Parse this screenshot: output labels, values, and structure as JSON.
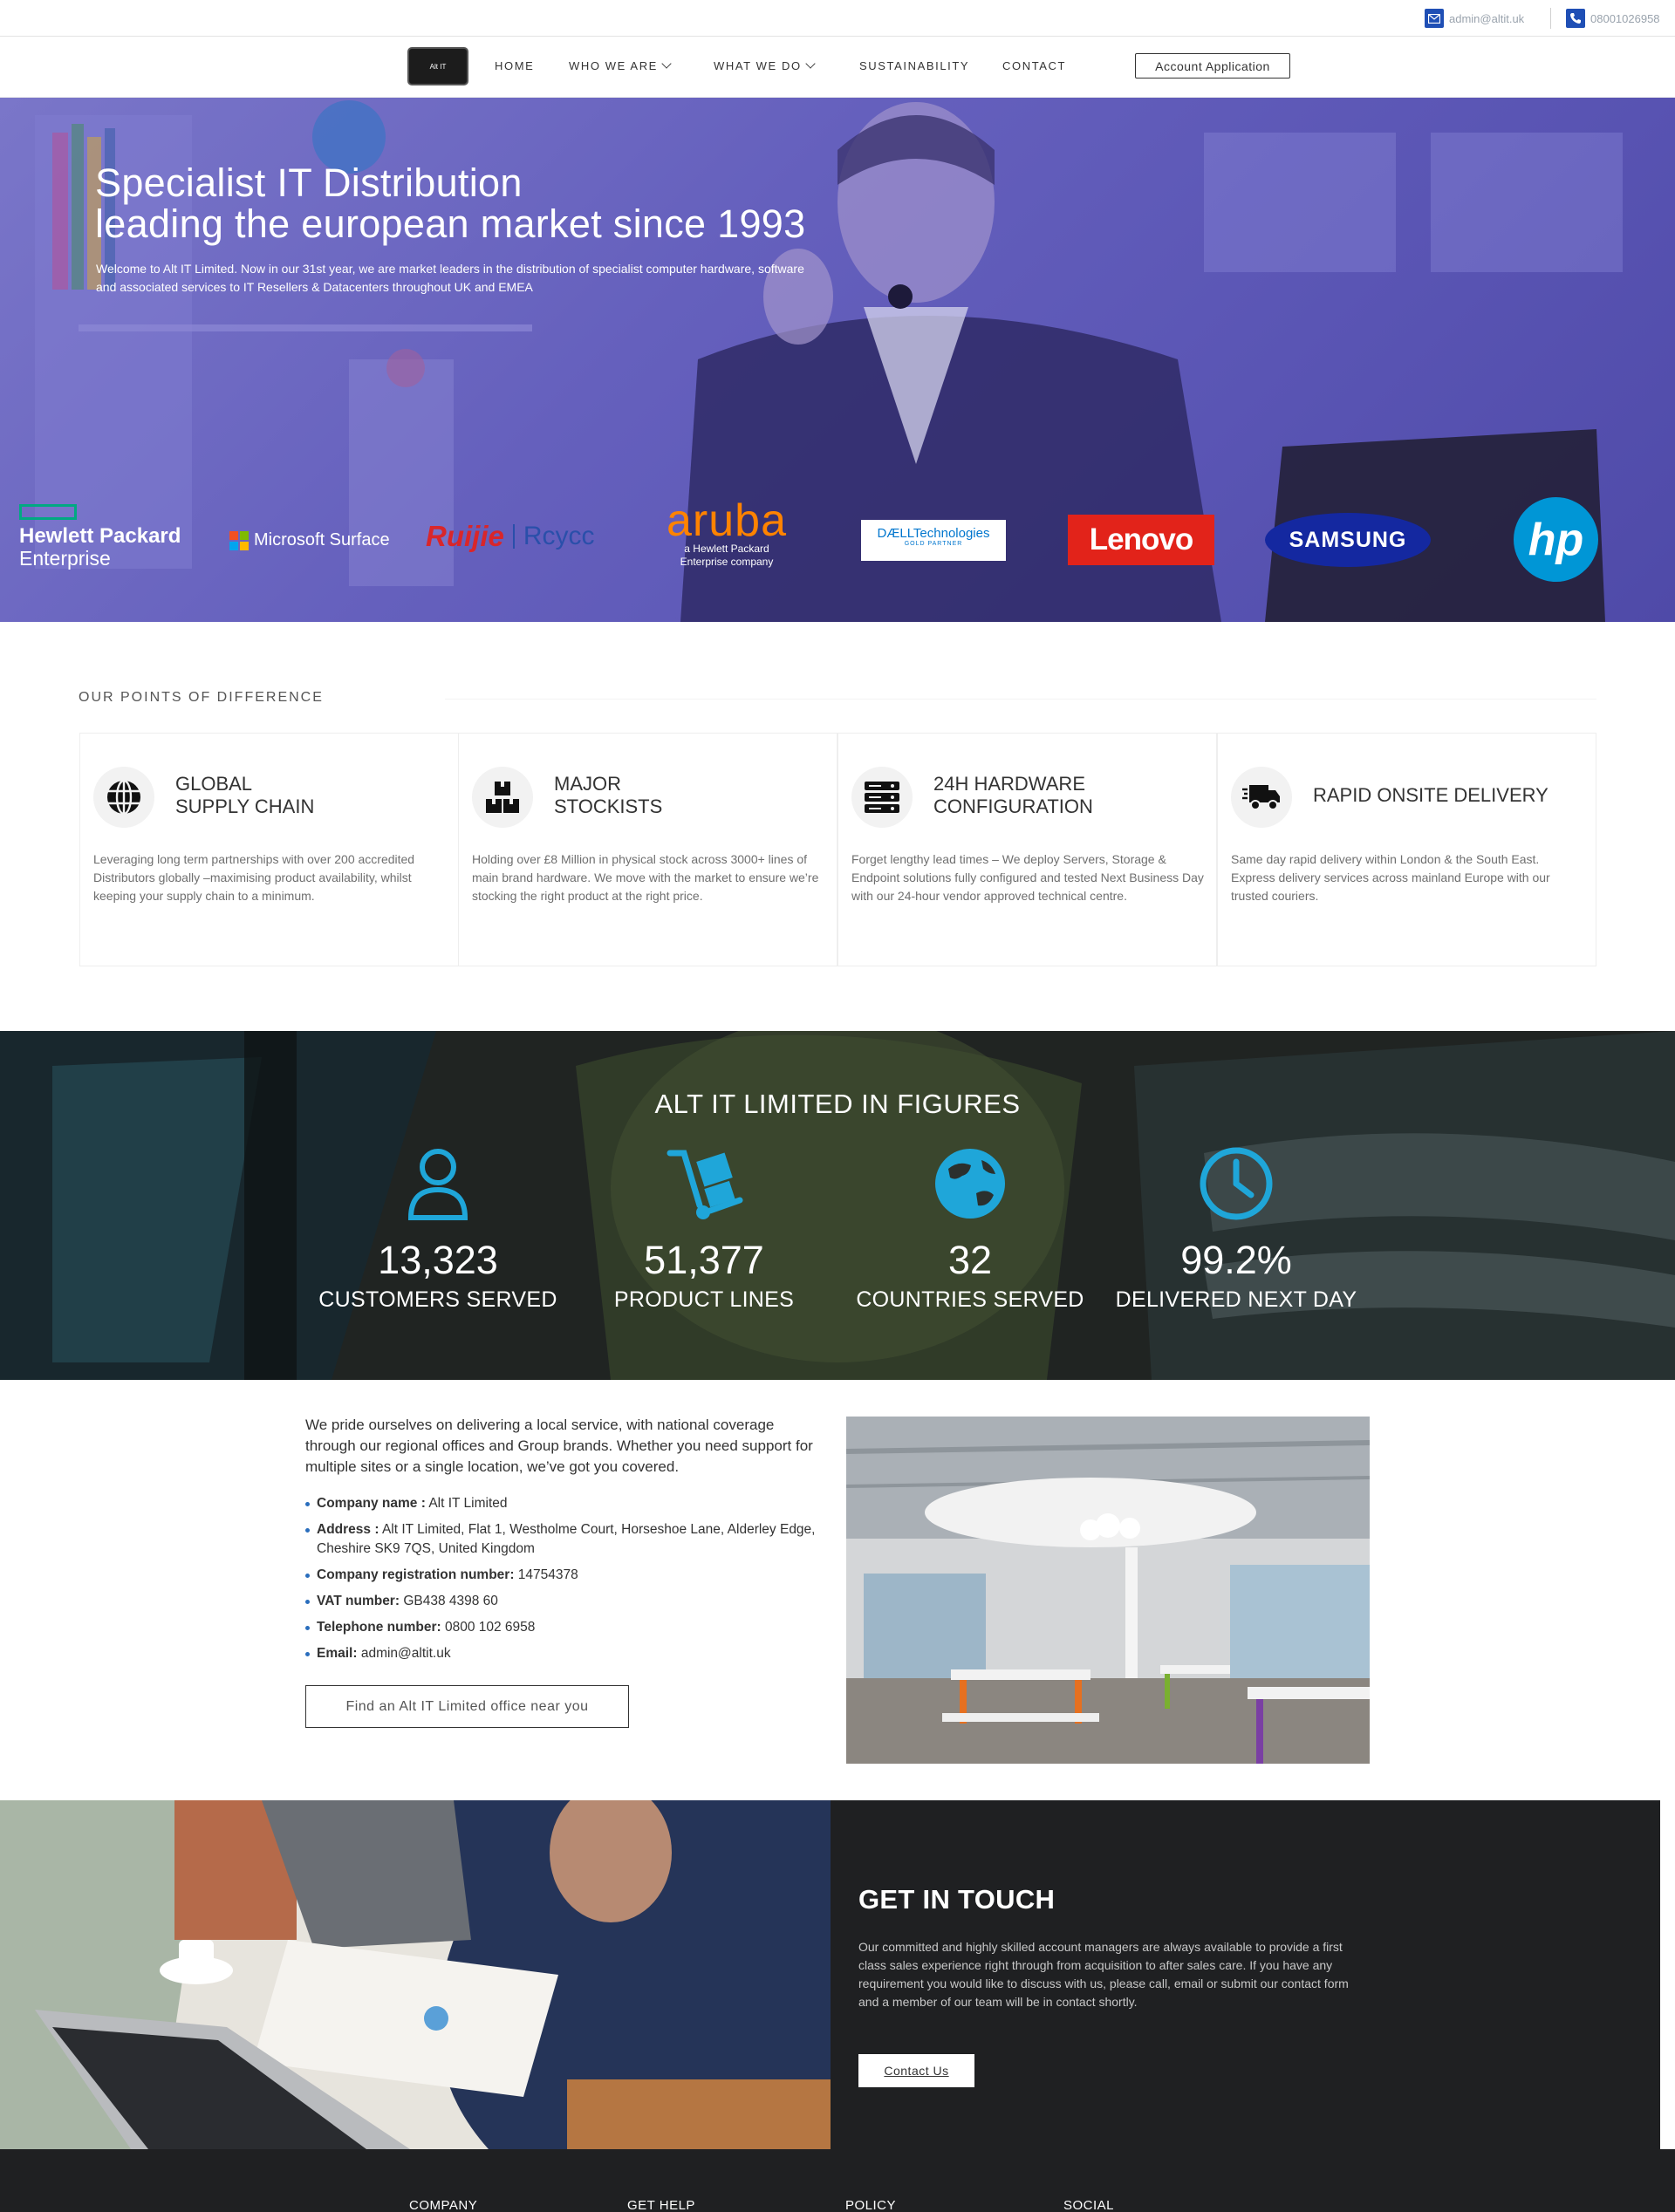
{
  "contact_bar": {
    "email": "admin@altit.uk",
    "phone": "08001026958",
    "email_icon": "envelope-icon",
    "phone_icon": "phone-icon"
  },
  "nav": {
    "logo_text": "Alt IT",
    "items": [
      "HOME",
      "WHO WE ARE",
      "WHAT WE DO",
      "SUSTAINABILITY",
      "CONTACT"
    ],
    "account_button": "Account Application"
  },
  "hero": {
    "title_line1": "Specialist IT Distribution",
    "title_line2": "leading the european market since 1993",
    "subtitle": "Welcome to Alt IT Limited. Now in our 31st year, we are market leaders in the distribution of specialist computer hardware, software and associated services to IT Resellers & Datacenters throughout UK and EMEA",
    "overlay_color": "#5f5ab8",
    "brands": {
      "hpe_line1": "Hewlett Packard",
      "hpe_line2": "Enterprise",
      "microsoft": "Microsoft Surface",
      "ruijie": "Ruijie",
      "reyee": "Rcycc",
      "aruba": "aruba",
      "aruba_tag1": "a Hewlett Packard",
      "aruba_tag2": "Enterprise company",
      "dell": "DÆLLTechnologies",
      "dell_tag": "GOLD PARTNER",
      "lenovo": "Lenovo",
      "samsung": "SAMSUNG",
      "hp": "hp"
    }
  },
  "points": {
    "heading": "OUR POINTS OF DIFFERENCE",
    "cards": [
      {
        "icon": "globe-icon",
        "title1": "GLOBAL",
        "title2": "SUPPLY CHAIN",
        "text": "Leveraging long term partnerships with over 200 accredited Distributors globally –maximising product availability, whilst keeping your supply chain to a minimum."
      },
      {
        "icon": "boxes-icon",
        "title1": "MAJOR",
        "title2": "STOCKISTS",
        "text": "Holding over £8 Million in physical stock across 3000+ lines of main brand hardware. We move with the market to ensure we’re stocking the right product at the right price."
      },
      {
        "icon": "server-icon",
        "title1": "24H HARDWARE",
        "title2": "CONFIGURATION",
        "text": "Forget lengthy lead times – We deploy Servers, Storage & Endpoint solutions fully configured and tested Next Business Day with our 24-hour vendor approved technical centre."
      },
      {
        "icon": "truck-icon",
        "title1": "RAPID ONSITE DELIVERY",
        "title2": "",
        "text": "Same day rapid delivery within London & the South East. Express delivery services across mainland Europe with our trusted couriers."
      }
    ]
  },
  "figures": {
    "title": "ALT IT LIMITED IN FIGURES",
    "accent": "#1fa6d9",
    "stats": [
      {
        "icon": "user-icon",
        "value": "13,323",
        "label": "CUSTOMERS SERVED"
      },
      {
        "icon": "hand-truck-icon",
        "value": "51,377",
        "label": "PRODUCT LINES"
      },
      {
        "icon": "globe-europe-icon",
        "value": "32",
        "label": "COUNTRIES SERVED"
      },
      {
        "icon": "clock-icon",
        "value": "99.2%",
        "label": "DELIVERED NEXT DAY"
      }
    ]
  },
  "company": {
    "intro": "We pride ourselves on delivering a local service, with national coverage through our regional offices and Group brands. Whether you need support for multiple sites or a single location, we’ve got you covered.",
    "items": [
      {
        "label": "Company name :",
        "value": " Alt IT Limited"
      },
      {
        "label": "Address :",
        "value": " Alt IT Limited, Flat 1, Westholme Court, Horseshoe Lane, Alderley Edge, Cheshire SK9 7QS, United Kingdom"
      },
      {
        "label": "Company registration number:",
        "value": " 14754378"
      },
      {
        "label": "VAT number:",
        "value": " GB438 4398 60"
      },
      {
        "label": "Telephone number:",
        "value": " 0800 102 6958"
      },
      {
        "label": "Email:",
        "value": " admin@altit.uk"
      }
    ],
    "find_button": "Find an Alt IT Limited office near you"
  },
  "touch": {
    "title": "GET IN TOUCH",
    "text": "Our committed and highly skilled account managers are always available to provide a first class sales experience right through from acquisition to after sales care. If you have any requirement you would like to discuss with us, please call, email or submit our contact form and a member of our team will be in contact shortly.",
    "button": "Contact Us"
  },
  "footer": {
    "columns": [
      "COMPANY",
      "GET HELP",
      "POLICY",
      "SOCIAL"
    ]
  }
}
